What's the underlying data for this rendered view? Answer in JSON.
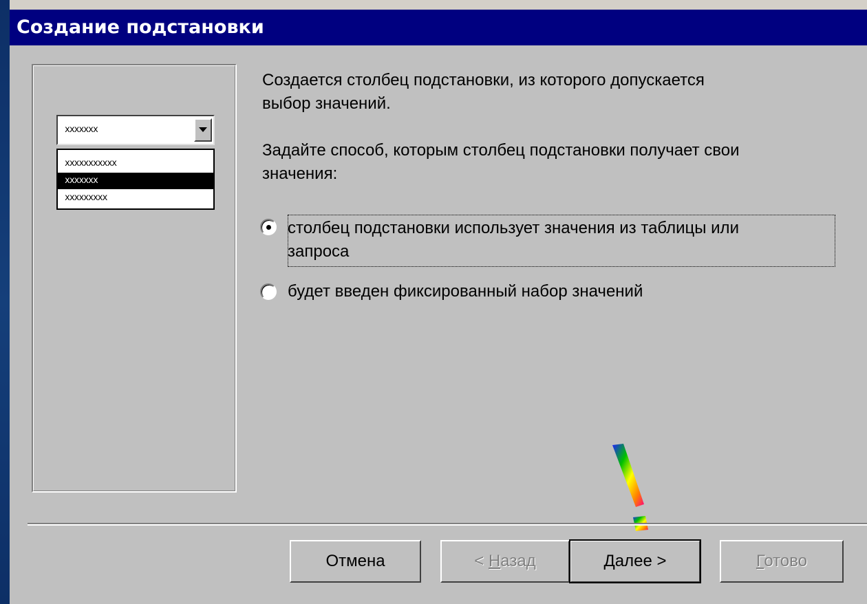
{
  "window": {
    "title": "Создание подстановки"
  },
  "preview": {
    "combo_value": "xxxxxxx",
    "list_items": [
      {
        "label": "xxxxxxxxxxx"
      },
      {
        "label": "xxxxxxx",
        "selected": true
      },
      {
        "label": "xxxxxxxxx"
      }
    ]
  },
  "content": {
    "intro_line1": "Создается столбец подстановки, из которого допускается",
    "intro_line2": "выбор значений.",
    "prompt_line1": "Задайте способ, которым столбец подстановки получает свои",
    "prompt_line2": "значения:"
  },
  "options": [
    {
      "line1": "столбец подстановки использует значения из таблицы или",
      "line2": "запроса",
      "selected": true
    },
    {
      "line1": "будет введен фиксированный набор значений",
      "selected": false
    }
  ],
  "buttons": {
    "cancel": "Отмена",
    "back_prefix": "< ",
    "back_accel": "Н",
    "back_rest": "азад",
    "next_accel": "Д",
    "next_rest": "алее >",
    "finish_accel": "Г",
    "finish_rest": "отово"
  },
  "colors": {
    "title_bar": "#000080",
    "dialog_bg": "#c0c0c0",
    "disabled_text": "#808080"
  },
  "icons": {
    "attention": "rainbow-exclamation-mark-icon",
    "dropdown": "chevron-down-icon"
  }
}
